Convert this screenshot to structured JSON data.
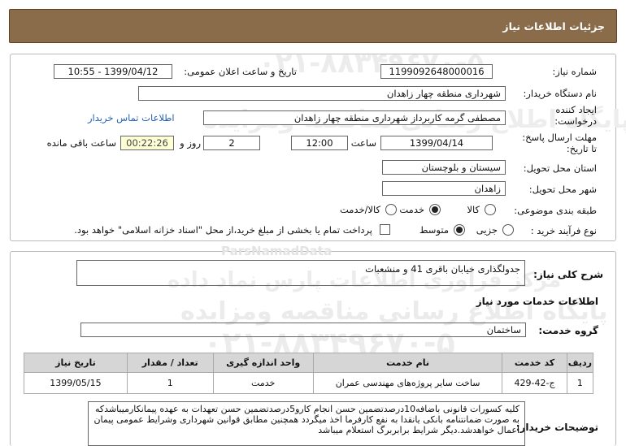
{
  "header": {
    "title": "جزئیات اطلاعات نیاز"
  },
  "info": {
    "need_number_label": "شماره نیاز:",
    "need_number": "1199092648000016",
    "announce_label": "تاریخ و ساعت اعلان عمومی:",
    "announce_value": "1399/04/12 - 10:55",
    "buyer_org_label": "نام دستگاه خریدار:",
    "buyer_org": "شهرداری منطقه چهار زاهدان",
    "requester_label_1": "ایجاد کننده",
    "requester_label_2": "درخواست:",
    "requester": "مصطفی گرمه کاربرداز شهرداری منطقه چهار زاهدان",
    "contact_link": "اطلاعات تماس خریدار",
    "deadline_label_1": "مهلت ارسال پاسخ:",
    "deadline_label_2": "تا تاریخ:",
    "deadline_date": "1399/04/14",
    "time_label": "ساعت",
    "deadline_time": "12:00",
    "days_value": "2",
    "days_label": "روز و",
    "timer": "00:22:26",
    "remaining_label": "ساعت باقی مانده",
    "province_label": "استان محل تحویل:",
    "province": "سیستان و بلوچستان",
    "city_label": "شهر محل تحویل:",
    "city": "زاهدان",
    "category_label": "طبقه بندی موضوعی:",
    "category_options": [
      "کالا",
      "خدمت",
      "کالا/خدمت"
    ],
    "category_selected": "خدمت",
    "process_label": "نوع فرآیند خرید :",
    "process_options": [
      "جزیی",
      "متوسط"
    ],
    "process_selected": "متوسط",
    "payment_note": "پرداخت تمام یا بخشی از مبلغ خرید،از محل \"اسناد خزانه اسلامی\" خواهد بود."
  },
  "need": {
    "summary_label": "شرح کلی نیاز:",
    "summary": "جدولگذاری خیابان باقری 41 و منشعبات",
    "services_heading": "اطلاعات خدمات مورد نیاز",
    "service_group_label": "گروه خدمت:",
    "service_group": "ساختمان"
  },
  "table": {
    "headers": [
      "ردیف",
      "کد خدمت",
      "نام خدمت",
      "واحد اندازه گیری",
      "تعداد / مقدار",
      "تاریخ نیاز"
    ],
    "rows": [
      [
        "1",
        "ج-42-429",
        "ساخت سایر پروژه‌های مهندسی عمران",
        "خدمت",
        "1",
        "1399/05/15"
      ]
    ]
  },
  "buyer_notes": {
    "label": "توضیحات خریدار:",
    "text": "کلیه کسورات قانونی باضافه10درصدتضمین حسن انجام کارو5درصدتضمین حسن تعهدات به عهده پیمانکارمیباشدکه به صورت ضمانتنامه بانکی یانقدا به نفع کارفرما اخذ میگردد همچنین مطابق قوانین شهرداری وشرایط عمومی پیمان اعمال خواهدشد.دیگر شرایط برابربرگ استعلام میباشد"
  },
  "watermark": {
    "brand_latin": "ParsNamadData",
    "brand_fa_1": "مرکز فراوری اطلاعات پارس نماد داده",
    "brand_fa_2": "پایگاه اطلاع رسانی مناقصه ومزایده",
    "phone": "۰۲۱-۸۸۳۴۹۶۷۰-۵"
  }
}
